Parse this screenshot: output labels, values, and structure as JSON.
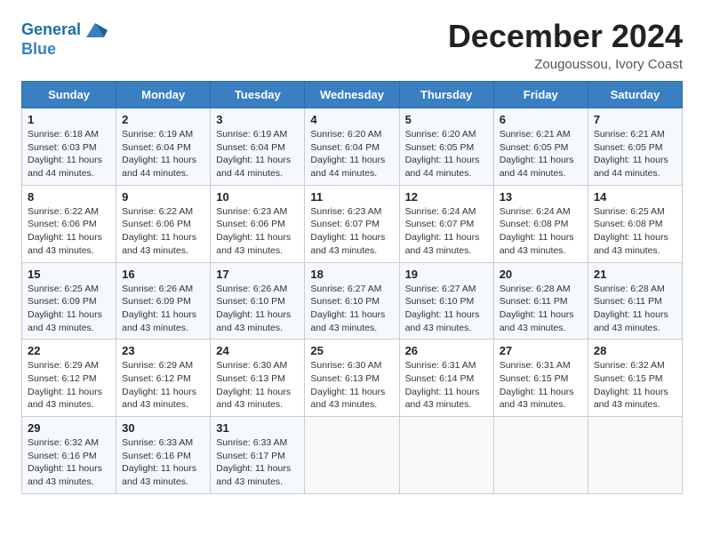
{
  "header": {
    "logo_line1": "General",
    "logo_line2": "Blue",
    "month_title": "December 2024",
    "location": "Zougoussou, Ivory Coast"
  },
  "weekdays": [
    "Sunday",
    "Monday",
    "Tuesday",
    "Wednesday",
    "Thursday",
    "Friday",
    "Saturday"
  ],
  "weeks": [
    [
      {
        "day": "1",
        "sunrise": "6:18 AM",
        "sunset": "6:03 PM",
        "daylight": "11 hours and 44 minutes."
      },
      {
        "day": "2",
        "sunrise": "6:19 AM",
        "sunset": "6:04 PM",
        "daylight": "11 hours and 44 minutes."
      },
      {
        "day": "3",
        "sunrise": "6:19 AM",
        "sunset": "6:04 PM",
        "daylight": "11 hours and 44 minutes."
      },
      {
        "day": "4",
        "sunrise": "6:20 AM",
        "sunset": "6:04 PM",
        "daylight": "11 hours and 44 minutes."
      },
      {
        "day": "5",
        "sunrise": "6:20 AM",
        "sunset": "6:05 PM",
        "daylight": "11 hours and 44 minutes."
      },
      {
        "day": "6",
        "sunrise": "6:21 AM",
        "sunset": "6:05 PM",
        "daylight": "11 hours and 44 minutes."
      },
      {
        "day": "7",
        "sunrise": "6:21 AM",
        "sunset": "6:05 PM",
        "daylight": "11 hours and 44 minutes."
      }
    ],
    [
      {
        "day": "8",
        "sunrise": "6:22 AM",
        "sunset": "6:06 PM",
        "daylight": "11 hours and 43 minutes."
      },
      {
        "day": "9",
        "sunrise": "6:22 AM",
        "sunset": "6:06 PM",
        "daylight": "11 hours and 43 minutes."
      },
      {
        "day": "10",
        "sunrise": "6:23 AM",
        "sunset": "6:06 PM",
        "daylight": "11 hours and 43 minutes."
      },
      {
        "day": "11",
        "sunrise": "6:23 AM",
        "sunset": "6:07 PM",
        "daylight": "11 hours and 43 minutes."
      },
      {
        "day": "12",
        "sunrise": "6:24 AM",
        "sunset": "6:07 PM",
        "daylight": "11 hours and 43 minutes."
      },
      {
        "day": "13",
        "sunrise": "6:24 AM",
        "sunset": "6:08 PM",
        "daylight": "11 hours and 43 minutes."
      },
      {
        "day": "14",
        "sunrise": "6:25 AM",
        "sunset": "6:08 PM",
        "daylight": "11 hours and 43 minutes."
      }
    ],
    [
      {
        "day": "15",
        "sunrise": "6:25 AM",
        "sunset": "6:09 PM",
        "daylight": "11 hours and 43 minutes."
      },
      {
        "day": "16",
        "sunrise": "6:26 AM",
        "sunset": "6:09 PM",
        "daylight": "11 hours and 43 minutes."
      },
      {
        "day": "17",
        "sunrise": "6:26 AM",
        "sunset": "6:10 PM",
        "daylight": "11 hours and 43 minutes."
      },
      {
        "day": "18",
        "sunrise": "6:27 AM",
        "sunset": "6:10 PM",
        "daylight": "11 hours and 43 minutes."
      },
      {
        "day": "19",
        "sunrise": "6:27 AM",
        "sunset": "6:10 PM",
        "daylight": "11 hours and 43 minutes."
      },
      {
        "day": "20",
        "sunrise": "6:28 AM",
        "sunset": "6:11 PM",
        "daylight": "11 hours and 43 minutes."
      },
      {
        "day": "21",
        "sunrise": "6:28 AM",
        "sunset": "6:11 PM",
        "daylight": "11 hours and 43 minutes."
      }
    ],
    [
      {
        "day": "22",
        "sunrise": "6:29 AM",
        "sunset": "6:12 PM",
        "daylight": "11 hours and 43 minutes."
      },
      {
        "day": "23",
        "sunrise": "6:29 AM",
        "sunset": "6:12 PM",
        "daylight": "11 hours and 43 minutes."
      },
      {
        "day": "24",
        "sunrise": "6:30 AM",
        "sunset": "6:13 PM",
        "daylight": "11 hours and 43 minutes."
      },
      {
        "day": "25",
        "sunrise": "6:30 AM",
        "sunset": "6:13 PM",
        "daylight": "11 hours and 43 minutes."
      },
      {
        "day": "26",
        "sunrise": "6:31 AM",
        "sunset": "6:14 PM",
        "daylight": "11 hours and 43 minutes."
      },
      {
        "day": "27",
        "sunrise": "6:31 AM",
        "sunset": "6:15 PM",
        "daylight": "11 hours and 43 minutes."
      },
      {
        "day": "28",
        "sunrise": "6:32 AM",
        "sunset": "6:15 PM",
        "daylight": "11 hours and 43 minutes."
      }
    ],
    [
      {
        "day": "29",
        "sunrise": "6:32 AM",
        "sunset": "6:16 PM",
        "daylight": "11 hours and 43 minutes."
      },
      {
        "day": "30",
        "sunrise": "6:33 AM",
        "sunset": "6:16 PM",
        "daylight": "11 hours and 43 minutes."
      },
      {
        "day": "31",
        "sunrise": "6:33 AM",
        "sunset": "6:17 PM",
        "daylight": "11 hours and 43 minutes."
      },
      null,
      null,
      null,
      null
    ]
  ]
}
